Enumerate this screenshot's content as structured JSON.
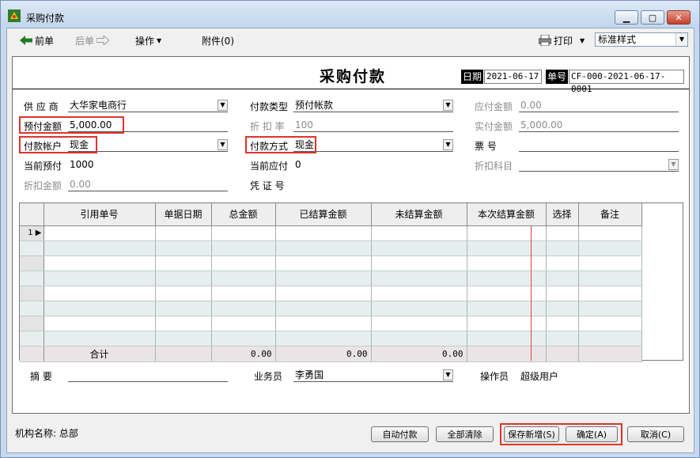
{
  "window": {
    "title": "采购付款"
  },
  "toolbar": {
    "prev_label": "前单",
    "next_label": "后单",
    "operate_label": "操作",
    "attach_label": "附件(0)",
    "print_label": "打印",
    "style_value": "标准样式"
  },
  "header": {
    "title": "采购付款",
    "date_label": "日期",
    "date_value": "2021-06-17",
    "docno_label": "单号",
    "docno_value": "CF-000-2021-06-17-0001"
  },
  "form": {
    "supplier_label": "供 应 商",
    "supplier_value": "大华家电商行",
    "pay_type_label": "付款类型",
    "pay_type_value": "预付帐款",
    "payable_label": "应付金额",
    "payable_value": "0.00",
    "prepay_label": "预付金额",
    "prepay_value": "5,000.00",
    "discount_rate_label": "折 扣 率",
    "discount_rate_value": "100",
    "actual_label": "实付金额",
    "actual_value": "5,000.00",
    "account_label": "付款帐户",
    "account_value": "现金",
    "method_label": "付款方式",
    "method_value": "现金",
    "ticket_label": "票    号",
    "ticket_value": "",
    "cur_prepay_label": "当前预付",
    "cur_prepay_value": "1000",
    "cur_payable_label": "当前应付",
    "cur_payable_value": "0",
    "discount_subject_label": "折扣科目",
    "discount_amt_label": "折扣金额",
    "discount_amt_value": "0.00",
    "voucher_label": "凭 证 号",
    "summary_label": "摘    要",
    "summary_value": "",
    "clerk_label": "业务员",
    "clerk_value": "李勇国",
    "operator_label": "操作员",
    "operator_value": "超级用户"
  },
  "grid": {
    "columns": [
      "引用单号",
      "单据日期",
      "总金额",
      "已结算金额",
      "未结算金额",
      "本次结算金额",
      "选择",
      "备注"
    ],
    "first_row_num": "1",
    "total_label": "合计",
    "total_amount": "0.00",
    "total_settled": "0.00",
    "total_unsettled": "0.00"
  },
  "footer": {
    "org_label": "机构名称: 总部",
    "auto_pay": "自动付款",
    "clear_all": "全部清除",
    "save_new": "保存新增(S)",
    "confirm": "确定(A)",
    "cancel": "取消(C)"
  },
  "colors": {
    "highlight": "#e0332a",
    "title_bar": "#c2d6ec",
    "grid_alt_row": "#e6efee",
    "total_row": "#ebe4e7"
  }
}
